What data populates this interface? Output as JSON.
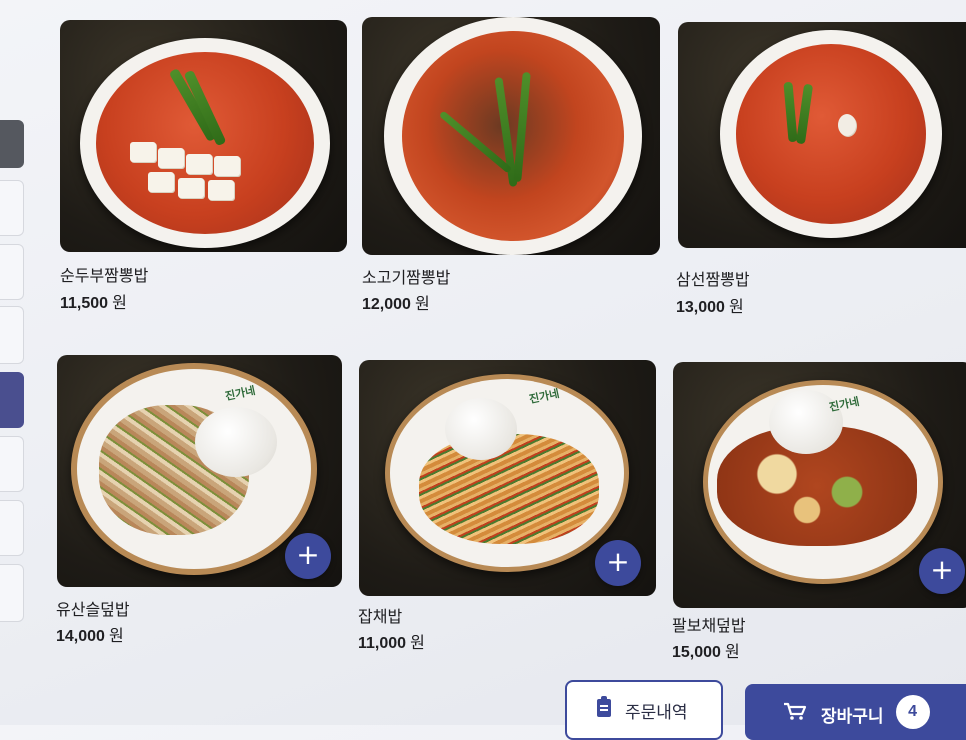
{
  "currency_unit": "원",
  "menu_items": [
    {
      "name": "순두부짬뽕밥",
      "price": "11,500",
      "has_add_button": false
    },
    {
      "name": "소고기짬뽕밥",
      "price": "12,000",
      "has_add_button": false
    },
    {
      "name": "삼선짬뽕밥",
      "price": "13,000",
      "has_add_button": false
    },
    {
      "name": "유산슬덮밥",
      "price": "14,000",
      "has_add_button": true
    },
    {
      "name": "잡채밥",
      "price": "11,000",
      "has_add_button": true
    },
    {
      "name": "팔보채덮밥",
      "price": "15,000",
      "has_add_button": true
    }
  ],
  "add_button_symbol": "+",
  "plate_logo_text": "진가네",
  "footer": {
    "order_history_label": "주문내역",
    "cart_label": "장바구니",
    "cart_count": "4"
  },
  "colors": {
    "accent": "#3d4a9c",
    "background": "#eef0f4"
  },
  "icons": {
    "order_history": "clipboard-icon",
    "cart": "cart-icon",
    "add": "plus-icon"
  }
}
